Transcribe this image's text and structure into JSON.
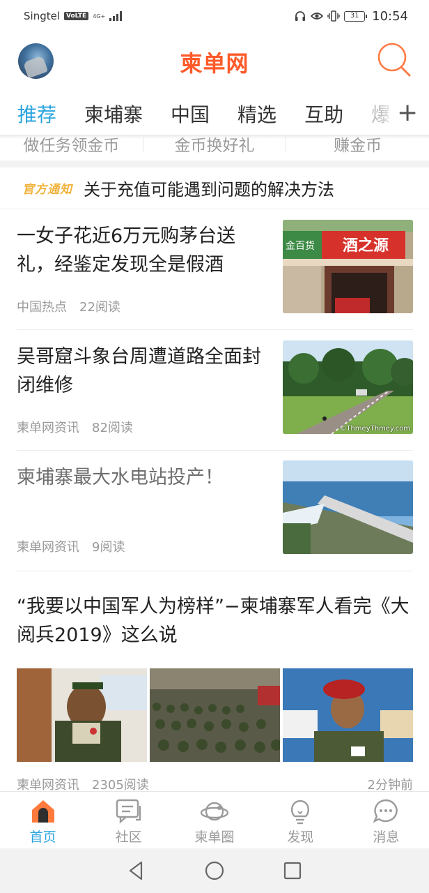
{
  "status_bar": {
    "carrier": "Singtel",
    "volte": "VoLTE",
    "network": "4G+",
    "battery": "31",
    "time": "10:54"
  },
  "header": {
    "title": "柬单网"
  },
  "tabs": [
    {
      "label": "推荐"
    },
    {
      "label": "柬埔寨"
    },
    {
      "label": "中国"
    },
    {
      "label": "精选"
    },
    {
      "label": "互助"
    },
    {
      "label": "爆"
    }
  ],
  "tabs_plus": "+",
  "coins": [
    {
      "label": "做任务领金币"
    },
    {
      "label": "金币换好礼"
    },
    {
      "label": "赚金币"
    }
  ],
  "notice": {
    "tag": "官方通知",
    "text": "关于充值可能遇到问题的解决方法"
  },
  "news": [
    {
      "title": "一女子花近6万元购茅台送礼，经鉴定发现全是假酒",
      "source": "中国热点",
      "reads": "22阅读"
    },
    {
      "title": "吴哥窟斗象台周遭道路全面封闭维修",
      "source": "柬单网资讯",
      "reads": "82阅读",
      "watermark": "©ThmeyThmey.com"
    },
    {
      "title": "柬埔寨最大水电站投产！",
      "source": "柬单网资讯",
      "reads": "9阅读"
    },
    {
      "title": "“我要以中国军人为榜样”−柬埔寨军人看完《大阅兵2019》这么说",
      "source": "柬单网资讯",
      "reads": "2305阅读",
      "time": "2分钟前"
    }
  ],
  "shop_sign": {
    "left": "金百货",
    "right": "酒之源"
  },
  "bottom_nav": [
    {
      "label": "首页",
      "icon": "home-icon"
    },
    {
      "label": "社区",
      "icon": "chat-icon"
    },
    {
      "label": "柬单圈",
      "icon": "planet-icon"
    },
    {
      "label": "发现",
      "icon": "bulb-icon"
    },
    {
      "label": "消息",
      "icon": "message-icon"
    }
  ],
  "colors": {
    "brand": "#ff5a2a",
    "accent": "#2aa4df",
    "notice_tag": "#f0b23a"
  }
}
